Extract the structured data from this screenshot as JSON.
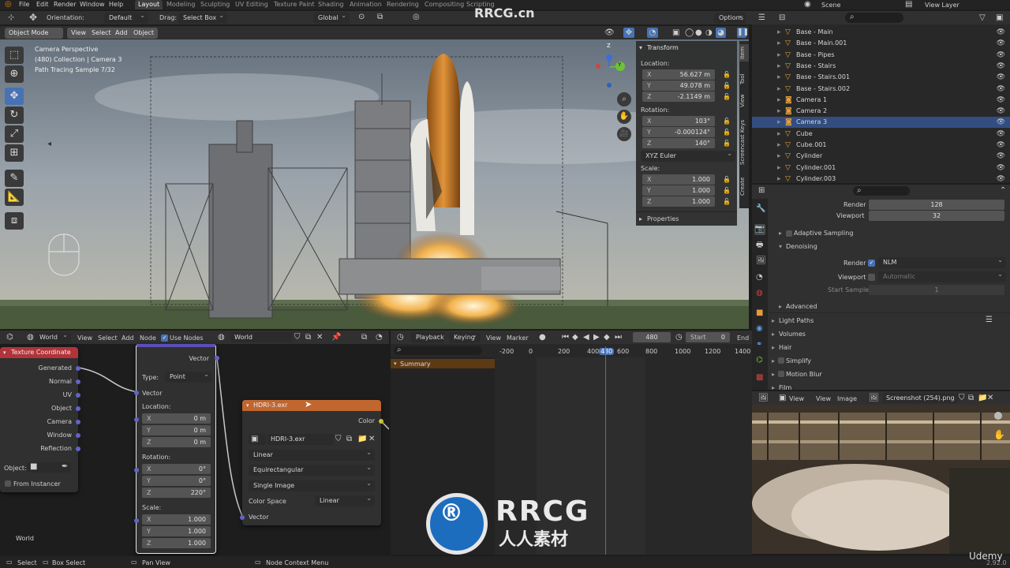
{
  "topbar": {
    "menus": [
      "File",
      "Edit",
      "Render",
      "Window",
      "Help"
    ],
    "workspaces": [
      "Layout",
      "Modeling",
      "Sculpting",
      "UV Editing",
      "Texture Paint",
      "Shading",
      "Animation",
      "Rendering",
      "Compositing",
      "Scripting"
    ],
    "active_workspace": "Layout",
    "scene": "Scene",
    "view_layer": "View Layer"
  },
  "viewport_header": {
    "orientation_label": "Orientation:",
    "orientation_value": "Default",
    "drag_label": "Drag:",
    "drag_value": "Select Box",
    "transform_orientation": "Global",
    "options": "Options",
    "mode": "Object Mode",
    "view": "View",
    "select": "Select",
    "add": "Add",
    "object": "Object"
  },
  "viewport_info": {
    "line1": "Camera Perspective",
    "line2": "(480) Collection | Camera 3",
    "line3": "Path Tracing Sample 7/32"
  },
  "gizmo": {
    "z": "Z",
    "y": "Y",
    "x": "X"
  },
  "npanel": {
    "transform": "Transform",
    "location": "Location:",
    "loc": [
      {
        "a": "X",
        "v": "56.627 m"
      },
      {
        "a": "Y",
        "v": "49.078 m"
      },
      {
        "a": "Z",
        "v": "-2.1149 m"
      }
    ],
    "rotation": "Rotation:",
    "rot": [
      {
        "a": "X",
        "v": "103°"
      },
      {
        "a": "Y",
        "v": "-0.000124°"
      },
      {
        "a": "Z",
        "v": "140°"
      }
    ],
    "rot_mode": "XYZ Euler",
    "scale": "Scale:",
    "scl": [
      {
        "a": "X",
        "v": "1.000"
      },
      {
        "a": "Y",
        "v": "1.000"
      },
      {
        "a": "Z",
        "v": "1.000"
      }
    ],
    "properties": "Properties"
  },
  "vtabs": [
    "Item",
    "Tool",
    "View",
    "Screencast Keys",
    "Create"
  ],
  "outliner": {
    "items": [
      {
        "name": "Base - Main"
      },
      {
        "name": "Base - Main.001"
      },
      {
        "name": "Base - Pipes"
      },
      {
        "name": "Base - Stairs"
      },
      {
        "name": "Base - Stairs.001"
      },
      {
        "name": "Base - Stairs.002"
      },
      {
        "name": "Camera 1"
      },
      {
        "name": "Camera 2"
      },
      {
        "name": "Camera 3"
      },
      {
        "name": "Cube"
      },
      {
        "name": "Cube.001"
      },
      {
        "name": "Cylinder"
      },
      {
        "name": "Cylinder.001"
      },
      {
        "name": "Cylinder.003"
      }
    ],
    "selected": "Camera 3"
  },
  "props": {
    "render_label": "Render",
    "render_value": "128",
    "viewport_label": "Viewport",
    "viewport_value": "32",
    "adaptive": "Adaptive Sampling",
    "denoising": "Denoising",
    "den_render": "Render",
    "den_render_value": "NLM",
    "den_viewport": "Viewport",
    "den_viewport_value": "Automatic",
    "start_sample": "Start Sample",
    "start_sample_value": "1",
    "advanced": "Advanced",
    "light_paths": "Light Paths",
    "volumes": "Volumes",
    "hair": "Hair",
    "simplify": "Simplify",
    "motion_blur": "Motion Blur",
    "film": "Film"
  },
  "image_editor": {
    "view": "View",
    "view2": "View",
    "image": "Image",
    "file": "Screenshot (254).png"
  },
  "node_editor": {
    "world": "World",
    "view": "View",
    "select": "Select",
    "add": "Add",
    "node": "Node",
    "use_nodes": "Use Nodes",
    "world_name": "World",
    "footer": "World"
  },
  "texcoord": {
    "title": "Texture Coordinate",
    "outputs": [
      "Generated",
      "Normal",
      "UV",
      "Object",
      "Camera",
      "Window",
      "Reflection"
    ],
    "object_label": "Object:",
    "from_instancer": "From Instancer"
  },
  "mapping": {
    "vector_out": "Vector",
    "type_label": "Type:",
    "type_value": "Point",
    "vector_in": "Vector",
    "location": "Location:",
    "loc": [
      {
        "a": "X",
        "v": "0 m"
      },
      {
        "a": "Y",
        "v": "0 m"
      },
      {
        "a": "Z",
        "v": "0 m"
      }
    ],
    "rotation": "Rotation:",
    "rot": [
      {
        "a": "X",
        "v": "0°"
      },
      {
        "a": "Y",
        "v": "0°"
      },
      {
        "a": "Z",
        "v": "220°"
      }
    ],
    "scale": "Scale:",
    "scl": [
      {
        "a": "X",
        "v": "1.000"
      },
      {
        "a": "Y",
        "v": "1.000"
      },
      {
        "a": "Z",
        "v": "1.000"
      }
    ]
  },
  "envtex": {
    "title": "HDRI-3.exr",
    "color_out": "Color",
    "image_name": "HDRI-3.exr",
    "interp": "Linear",
    "projection": "Equirectangular",
    "source": "Single Image",
    "colorspace_label": "Color Space",
    "colorspace_value": "Linear",
    "vector_in": "Vector"
  },
  "timeline": {
    "playback": "Playback",
    "keying": "Keying",
    "view": "View",
    "marker": "Marker",
    "frame": "480",
    "start_label": "Start",
    "start_value": "0",
    "end_label": "End",
    "ticks": [
      "-200",
      "0",
      "200",
      "400",
      "480",
      "600",
      "800",
      "1000",
      "1200",
      "1400"
    ],
    "summary": "Summary"
  },
  "status": {
    "select": "Select",
    "box_select": "Box Select",
    "pan_view": "Pan View",
    "context_menu": "Node Context Menu",
    "version": "2.92.0"
  },
  "watermark": {
    "brand": "RRCG",
    "sub": "人人素材",
    "top": "RRCG.cn",
    "udemy": "Udemy"
  },
  "colors": {
    "accent": "#4772b3",
    "texcoord_header": "#b2333a",
    "envtex_header": "#c1662f",
    "mapping_header": "#5a4fb4",
    "selected_row": "#334d80"
  }
}
